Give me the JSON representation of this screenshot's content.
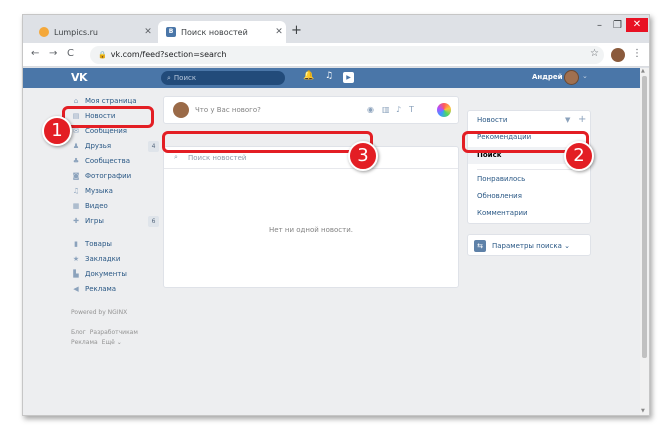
{
  "browser": {
    "tabs": [
      {
        "title": "Lumpics.ru"
      },
      {
        "title": "Поиск новостей"
      }
    ],
    "new_tab_symbol": "+",
    "url": "vk.com/feed?section=search",
    "window_controls": [
      "–",
      "❐",
      "✕"
    ]
  },
  "vk_header": {
    "logo": "VK",
    "search_placeholder": "Поиск",
    "user_name": "Андрей"
  },
  "left_nav": {
    "items": [
      {
        "label": "Моя страница",
        "icon": "home-icon",
        "count": ""
      },
      {
        "label": "Новости",
        "icon": "news-icon",
        "count": ""
      },
      {
        "label": "Сообщения",
        "icon": "messages-icon",
        "count": ""
      },
      {
        "label": "Друзья",
        "icon": "friends-icon",
        "count": "4"
      },
      {
        "label": "Сообщества",
        "icon": "groups-icon",
        "count": ""
      },
      {
        "label": "Фотографии",
        "icon": "photos-icon",
        "count": ""
      },
      {
        "label": "Музыка",
        "icon": "music-icon",
        "count": ""
      },
      {
        "label": "Видео",
        "icon": "video-icon",
        "count": ""
      },
      {
        "label": "Игры",
        "icon": "games-icon",
        "count": "6"
      }
    ],
    "items2": [
      {
        "label": "Товары",
        "icon": "goods-icon"
      },
      {
        "label": "Закладки",
        "icon": "bookmarks-icon"
      },
      {
        "label": "Документы",
        "icon": "documents-icon"
      },
      {
        "label": "Реклама",
        "icon": "ads-icon"
      }
    ],
    "powered": "Powered by NGINX",
    "footer_row1": [
      "Блог",
      "Разработчикам"
    ],
    "footer_row2": [
      "Реклама",
      "Ещё ⌄"
    ]
  },
  "post_box": {
    "placeholder": "Что у Вас нового?"
  },
  "feed": {
    "search_placeholder": "Поиск новостей",
    "empty_text": "Нет ни одной новости."
  },
  "right_menu": {
    "items": [
      "Новости",
      "Рекомендации",
      "Поиск",
      "Понравилось",
      "Обновления",
      "Комментарии"
    ],
    "selected": "Поиск",
    "params_label": "Параметры поиска ⌄"
  },
  "annotations": {
    "badges": [
      "1",
      "2",
      "3"
    ],
    "color": "#e31e24"
  },
  "colors": {
    "vk_blue": "#4a76a8",
    "link": "#2a5885",
    "highlight": "#e31e24"
  }
}
